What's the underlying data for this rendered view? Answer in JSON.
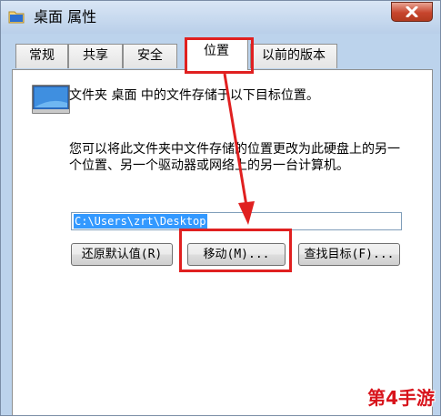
{
  "window": {
    "title": "桌面 属性",
    "close_icon": "close-icon"
  },
  "tabs": [
    {
      "label": "常规"
    },
    {
      "label": "共享"
    },
    {
      "label": "安全"
    },
    {
      "label": "位置"
    },
    {
      "label": "以前的版本"
    }
  ],
  "location": {
    "description": "文件夹 桌面 中的文件存储于以下目标位置。",
    "instruction": "您可以将此文件夹中文件存储的位置更改为此硬盘上的另一个位置、另一个驱动器或网络上的另一台计算机。",
    "path_value": "C:\\Users\\zrt\\Desktop"
  },
  "buttons": {
    "restore_default": "还原默认值(R)",
    "move": "移动(M)...",
    "find_target": "查找目标(F)..."
  },
  "watermark": "第4手游",
  "colors": {
    "highlight": "#e02020",
    "selection": "#3399ff"
  }
}
